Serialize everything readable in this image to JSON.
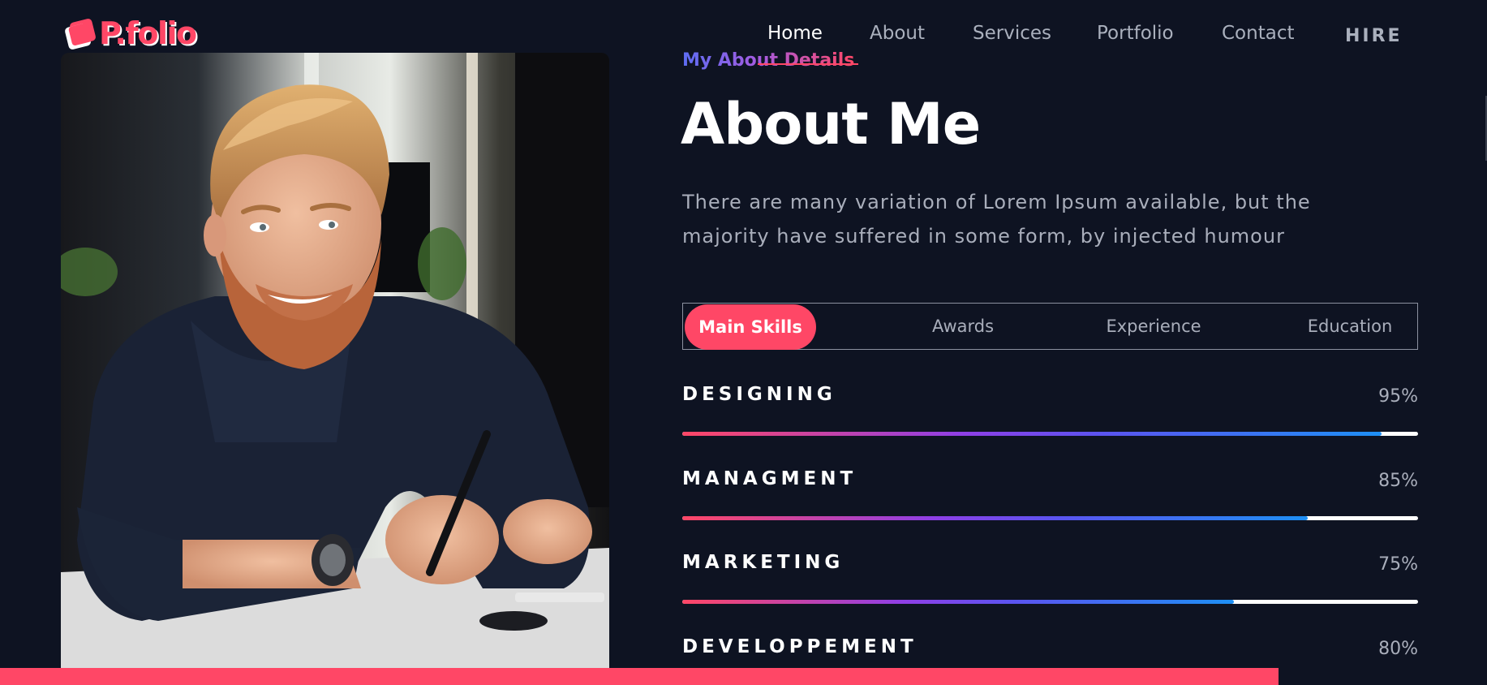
{
  "logo": {
    "text": "P.folio"
  },
  "nav": {
    "items": [
      {
        "label": "Home",
        "active": true
      },
      {
        "label": "About",
        "active": false
      },
      {
        "label": "Services",
        "active": false
      },
      {
        "label": "Portfolio",
        "active": false
      },
      {
        "label": "Contact",
        "active": false
      }
    ],
    "hire_label": "HIRE"
  },
  "about": {
    "eyebrow": "My About Details",
    "title": "About Me",
    "description": "There are many variation of Lorem Ipsum available, but the majority have suffered in some form, by injected humour"
  },
  "tabs": [
    {
      "label": "Main Skills",
      "active": true
    },
    {
      "label": "Awards",
      "active": false
    },
    {
      "label": "Experience",
      "active": false
    },
    {
      "label": "Education",
      "active": false
    }
  ],
  "skills": [
    {
      "name": "DESIGNING",
      "value_label": "95%",
      "value": 95
    },
    {
      "name": "MANAGMENT",
      "value_label": "85%",
      "value": 85
    },
    {
      "name": "MARKETING",
      "value_label": "75%",
      "value": 75
    },
    {
      "name": "DEVELOPPEMENT",
      "value_label": "80%",
      "value": 80
    }
  ],
  "scroll_progress": 86,
  "colors": {
    "accent": "#ff4766",
    "background": "#0e1322",
    "text_muted": "#a9aebb"
  }
}
